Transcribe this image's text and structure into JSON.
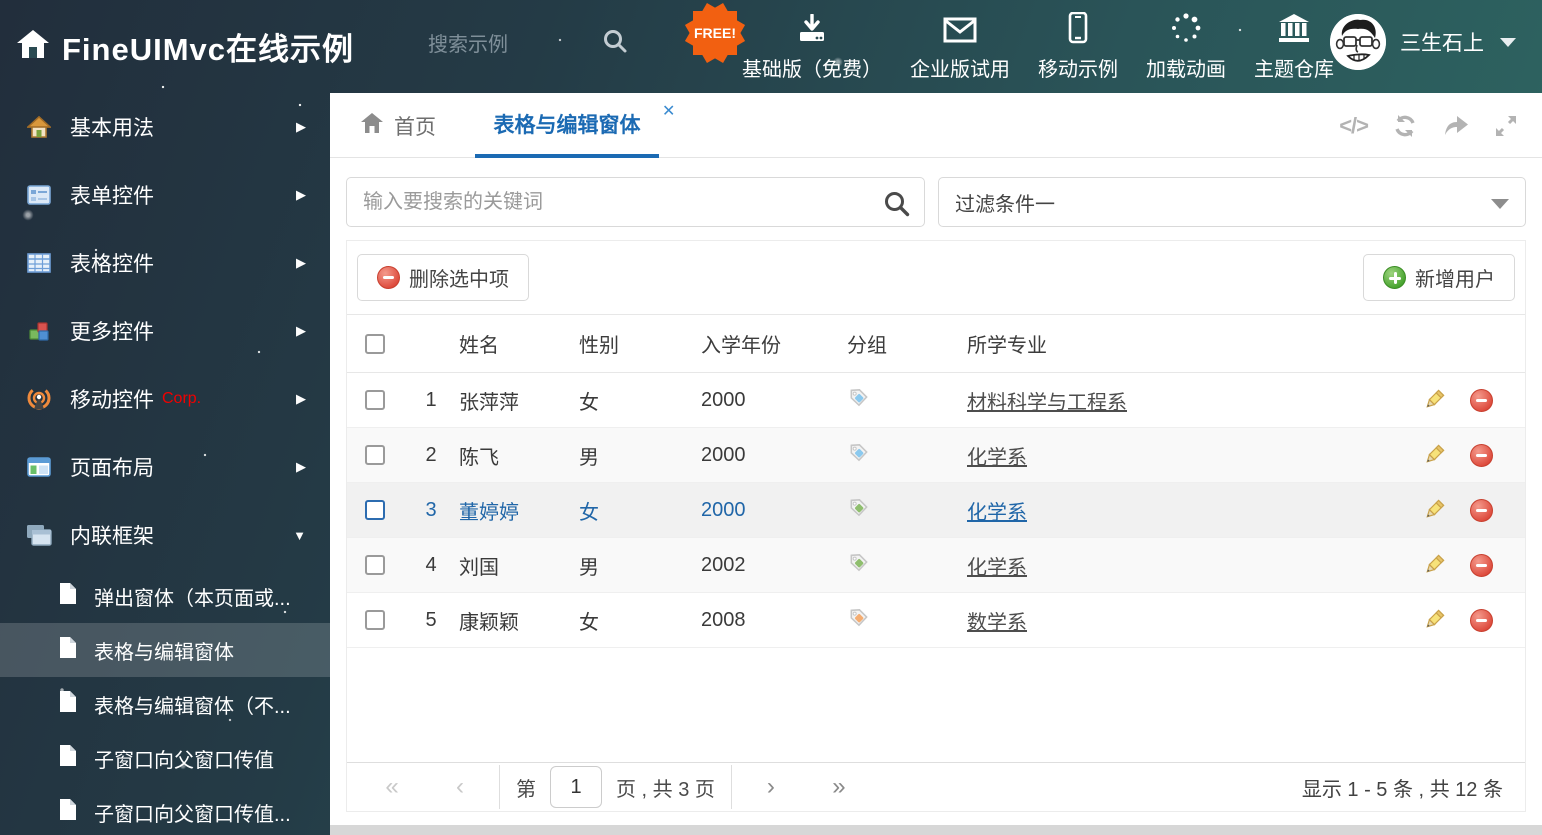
{
  "header": {
    "title": "FineUIMvc在线示例",
    "search_placeholder": "搜索示例",
    "free_badge": "FREE!",
    "nav_items": [
      {
        "icon": "download-icon",
        "label": "基础版（免费）"
      },
      {
        "icon": "mail-icon",
        "label": "企业版试用"
      },
      {
        "icon": "mobile-icon",
        "label": "移动示例"
      },
      {
        "icon": "spinner-icon",
        "label": "加载动画"
      },
      {
        "icon": "bank-icon",
        "label": "主题仓库"
      }
    ],
    "username": "三生石上"
  },
  "sidebar": {
    "items": [
      {
        "icon": "house-icon",
        "label": "基本用法"
      },
      {
        "icon": "form-icon",
        "label": "表单控件"
      },
      {
        "icon": "grid-icon",
        "label": "表格控件"
      },
      {
        "icon": "cubes-icon",
        "label": "更多控件"
      },
      {
        "icon": "antenna-icon",
        "label": "移动控件",
        "badge": "Corp."
      },
      {
        "icon": "layout-icon",
        "label": "页面布局"
      },
      {
        "icon": "frames-icon",
        "label": "内联框架"
      }
    ],
    "subitems": [
      {
        "label": "弹出窗体（本页面或..."
      },
      {
        "label": "表格与编辑窗体"
      },
      {
        "label": "表格与编辑窗体（不..."
      },
      {
        "label": "子窗口向父窗口传值"
      },
      {
        "label": "子窗口向父窗口传值..."
      }
    ]
  },
  "tabs": {
    "home": "首页",
    "active": "表格与编辑窗体"
  },
  "filters": {
    "search_placeholder": "输入要搜索的关键词",
    "filter_value": "过滤条件一"
  },
  "toolbar": {
    "delete_label": "删除选中项",
    "add_label": "新增用户"
  },
  "table": {
    "columns": [
      "姓名",
      "性别",
      "入学年份",
      "分组",
      "所学专业"
    ],
    "rows": [
      {
        "num": "1",
        "name": "张萍萍",
        "gender": "女",
        "year": "2000",
        "tag_color": "#8bc9ee",
        "major": "材料科学与工程系"
      },
      {
        "num": "2",
        "name": "陈飞",
        "gender": "男",
        "year": "2000",
        "tag_color": "#8bc9ee",
        "major": "化学系"
      },
      {
        "num": "3",
        "name": "董婷婷",
        "gender": "女",
        "year": "2000",
        "tag_color": "#8fbe6e",
        "major": "化学系"
      },
      {
        "num": "4",
        "name": "刘国",
        "gender": "男",
        "year": "2002",
        "tag_color": "#8fbe6e",
        "major": "化学系"
      },
      {
        "num": "5",
        "name": "康颖颖",
        "gender": "女",
        "year": "2008",
        "tag_color": "#f4ad72",
        "major": "数学系"
      }
    ]
  },
  "pagination": {
    "page_prefix": "第",
    "current_page": "1",
    "page_suffix": "页 , 共 3 页",
    "summary": "显示 1 - 5 条 , 共 12 条"
  },
  "glyphs": {
    "chevron_right": "▶",
    "chevron_down": "▼",
    "close": "✕",
    "code": "</>",
    "first": "«",
    "prev": "‹",
    "next": "›",
    "last": "»"
  },
  "colors": {
    "accent_blue": "#1b6ab3",
    "danger_red": "#dd4a3c",
    "success_green": "#46a32e",
    "badge_orange": "#f26011",
    "corp_red": "#f00000"
  }
}
